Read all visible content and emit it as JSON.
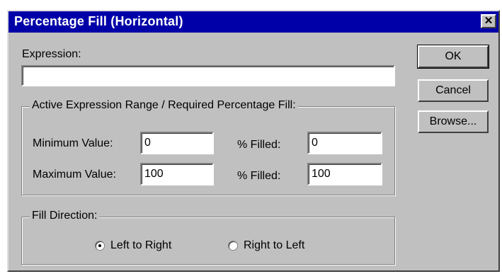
{
  "window": {
    "title": "Percentage Fill (Horizontal)",
    "close_glyph": "✕"
  },
  "expression": {
    "label": "Expression:",
    "value": ""
  },
  "range_group": {
    "title": "Active Expression Range / Required Percentage Fill:",
    "min_label": "Minimum Value:",
    "min_value": "0",
    "min_filled_label": "% Filled:",
    "min_filled_value": "0",
    "max_label": "Maximum Value:",
    "max_value": "100",
    "max_filled_label": "% Filled:",
    "max_filled_value": "100"
  },
  "direction_group": {
    "title": "Fill Direction:",
    "options": [
      {
        "label": "Left to Right",
        "selected": true
      },
      {
        "label": "Right to Left",
        "selected": false
      }
    ]
  },
  "buttons": {
    "ok": "OK",
    "cancel": "Cancel",
    "browse": "Browse..."
  },
  "colors": {
    "titlebar": "#0000a8",
    "face": "#c0c0c0"
  }
}
